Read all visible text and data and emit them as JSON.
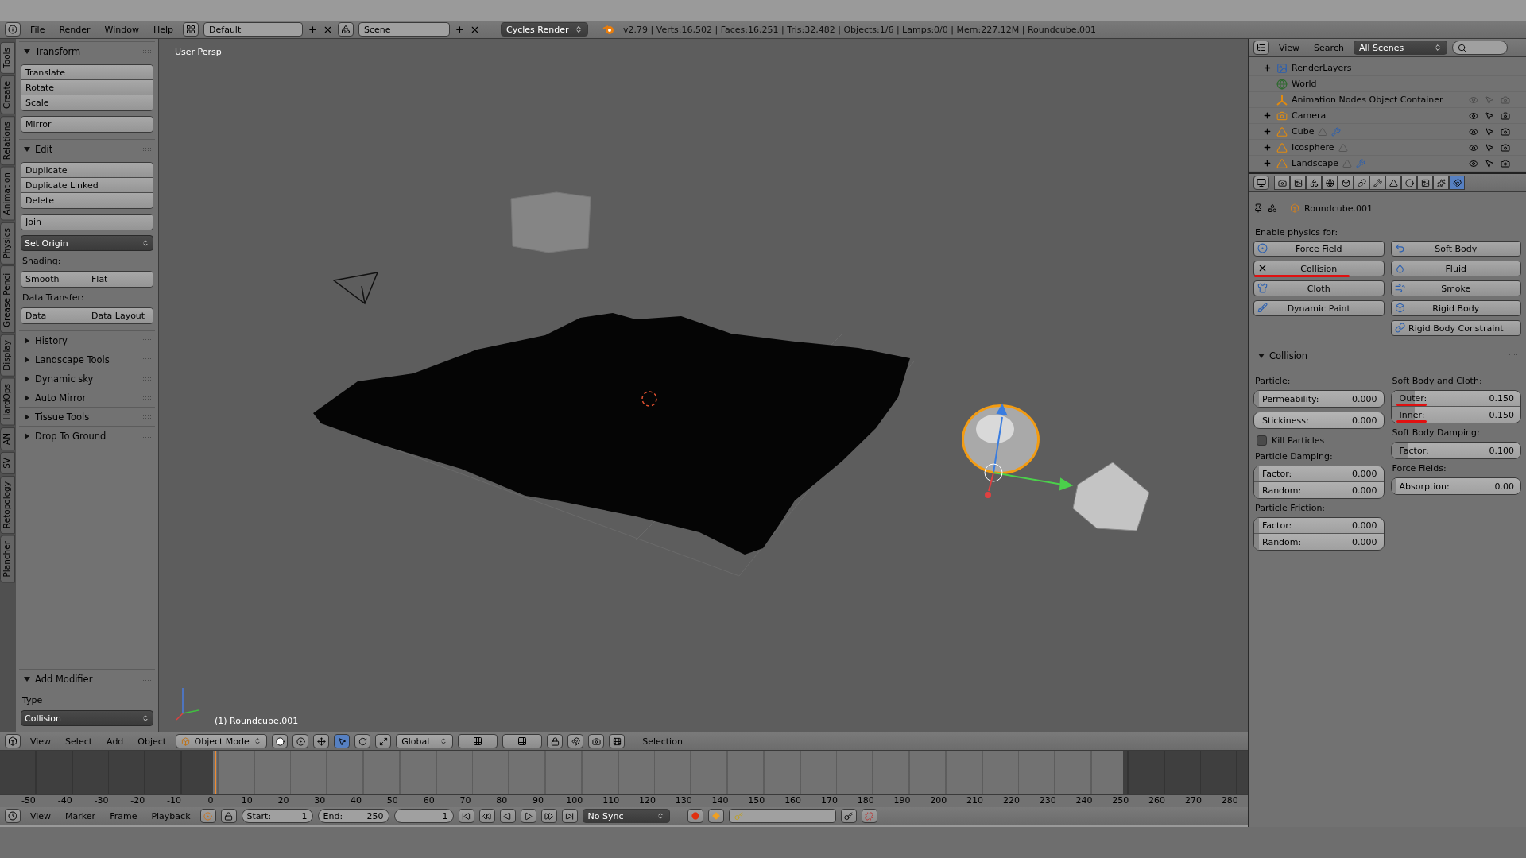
{
  "top_bar": {
    "menus": [
      "File",
      "Render",
      "Window",
      "Help"
    ],
    "layout": "Default",
    "scene": "Scene",
    "engine": "Cycles Render",
    "stats": "v2.79 | Verts:16,502 | Faces:16,251 | Tris:32,482 | Objects:1/6 | Lamps:0/0 | Mem:227.12M | Roundcube.001"
  },
  "side_tabs": [
    {
      "label": "Tools",
      "selected": true
    },
    {
      "label": "Create",
      "selected": false
    },
    {
      "label": "Relations",
      "selected": false
    },
    {
      "label": "Animation",
      "selected": false
    },
    {
      "label": "Physics",
      "selected": false
    },
    {
      "label": "Grease Pencil",
      "selected": false
    },
    {
      "label": "Display",
      "selected": false
    },
    {
      "label": "HardOps",
      "selected": false
    },
    {
      "label": "AN",
      "selected": false
    },
    {
      "label": "SV",
      "selected": false
    },
    {
      "label": "Retopology",
      "selected": false
    },
    {
      "label": "Plancher",
      "selected": false
    }
  ],
  "tool_shelf": {
    "panels": [
      {
        "title": "Transform",
        "expanded": true,
        "rows": [
          {
            "kind": "group",
            "buttons": [
              "Translate",
              "Rotate",
              "Scale"
            ]
          },
          {
            "kind": "group",
            "buttons": [
              "Mirror"
            ]
          }
        ]
      },
      {
        "title": "Edit",
        "expanded": true,
        "rows": [
          {
            "kind": "group",
            "buttons": [
              "Duplicate",
              "Duplicate Linked",
              "Delete"
            ]
          },
          {
            "kind": "group",
            "buttons": [
              "Join"
            ]
          },
          {
            "kind": "menu",
            "label": "Set Origin"
          },
          {
            "kind": "label",
            "text": "Shading:"
          },
          {
            "kind": "pair",
            "buttons": [
              "Smooth",
              "Flat"
            ]
          },
          {
            "kind": "label",
            "text": "Data Transfer:"
          },
          {
            "kind": "pair",
            "buttons": [
              "Data",
              "Data Layout"
            ]
          }
        ]
      },
      {
        "title": "History",
        "expanded": false
      },
      {
        "title": "Landscape Tools",
        "expanded": false
      },
      {
        "title": "Dynamic sky",
        "expanded": false
      },
      {
        "title": "Auto Mirror",
        "expanded": false
      },
      {
        "title": "Tissue Tools",
        "expanded": false
      },
      {
        "title": "Drop To Ground",
        "expanded": false
      }
    ]
  },
  "add_modifier": {
    "title": "Add Modifier",
    "expanded": true,
    "type_label": "Type",
    "type_value": "Collision"
  },
  "viewport": {
    "view_name": "User Persp",
    "object_label": "(1) Roundcube.001"
  },
  "viewport_header": {
    "menus": [
      "View",
      "Select",
      "Add",
      "Object"
    ],
    "mode": "Object Mode",
    "orientation": "Global",
    "status": "Selection"
  },
  "timeline": {
    "ticks": [
      "-50",
      "-40",
      "-30",
      "-20",
      "-10",
      "0",
      "10",
      "20",
      "30",
      "40",
      "50",
      "60",
      "70",
      "80",
      "90",
      "100",
      "110",
      "120",
      "130",
      "140",
      "150",
      "160",
      "170",
      "180",
      "190",
      "200",
      "210",
      "220",
      "230",
      "240",
      "250",
      "260",
      "270",
      "280"
    ]
  },
  "timeline_header": {
    "menus": [
      "View",
      "Marker",
      "Frame",
      "Playback"
    ],
    "start_label": "Start:",
    "start": "1",
    "end_label": "End:",
    "end": "250",
    "current_frame": "1",
    "sync": "No Sync"
  },
  "outliner": {
    "menus": [
      "View",
      "Search"
    ],
    "scope": "All Scenes",
    "items": [
      {
        "name": "RenderLayers",
        "kind": "render_layers",
        "modifiers": false
      },
      {
        "name": "World",
        "kind": "world",
        "modifiers": false
      },
      {
        "name": "Animation Nodes Object Container",
        "kind": "empty",
        "modifiers": false
      },
      {
        "name": "Camera",
        "kind": "camera",
        "modifiers": false
      },
      {
        "name": "Cube",
        "kind": "mesh",
        "modifiers": true
      },
      {
        "name": "Icosphere",
        "kind": "mesh",
        "modifiers": false
      },
      {
        "name": "Landscape",
        "kind": "mesh",
        "modifiers": true
      }
    ]
  },
  "properties": {
    "tabs": [
      {
        "kind": "render",
        "selected": false
      },
      {
        "kind": "render_layers",
        "selected": false
      },
      {
        "kind": "scene",
        "selected": false
      },
      {
        "kind": "world",
        "selected": false
      },
      {
        "kind": "object",
        "selected": false
      },
      {
        "kind": "constraints",
        "selected": false
      },
      {
        "kind": "modifiers",
        "selected": false
      },
      {
        "kind": "data",
        "selected": false
      },
      {
        "kind": "material",
        "selected": false
      },
      {
        "kind": "texture",
        "selected": false
      },
      {
        "kind": "particles",
        "selected": false
      },
      {
        "kind": "physics",
        "selected": true
      }
    ],
    "context": "Roundcube.001",
    "physics_label": "Enable physics for:",
    "physics_columns": [
      [
        {
          "label": "Force Field",
          "kind": "force_field",
          "enabled": false,
          "underlined": false
        },
        {
          "label": "Collision",
          "kind": "collision",
          "enabled": true,
          "underlined": true
        },
        {
          "label": "Cloth",
          "kind": "cloth",
          "enabled": false,
          "underlined": false
        },
        {
          "label": "Dynamic Paint",
          "kind": "dynamic_paint",
          "enabled": false,
          "underlined": false
        }
      ],
      [
        {
          "label": "Soft Body",
          "kind": "soft_body",
          "enabled": false,
          "underlined": false
        },
        {
          "label": "Fluid",
          "kind": "fluid",
          "enabled": false,
          "underlined": false
        },
        {
          "label": "Smoke",
          "kind": "smoke",
          "enabled": false,
          "underlined": false
        },
        {
          "label": "Rigid Body",
          "kind": "rigid_body",
          "enabled": false,
          "underlined": false
        },
        {
          "label": "Rigid Body Constraint",
          "kind": "rigid_body_constraint",
          "enabled": false,
          "underlined": false
        }
      ]
    ],
    "collision": {
      "title": "Collision",
      "expanded": true,
      "columns": [
        [
          {
            "kind": "label",
            "text": "Particle:"
          },
          {
            "kind": "sliders",
            "fields": [
              {
                "label": "Permeability:",
                "value": "0.000",
                "level": 0,
                "underlined": false
              }
            ]
          },
          {
            "kind": "spinner",
            "fields": [
              {
                "label": "Stickiness:",
                "value": "0.000",
                "underlined": false
              }
            ]
          },
          {
            "kind": "checkbox",
            "label": "Kill Particles",
            "checked": false
          },
          {
            "kind": "label",
            "text": "Particle Damping:"
          },
          {
            "kind": "sliders",
            "fields": [
              {
                "label": "Factor:",
                "value": "0.000",
                "level": 0,
                "underlined": false
              },
              {
                "label": "Random:",
                "value": "0.000",
                "level": 0,
                "underlined": false
              }
            ]
          },
          {
            "kind": "label",
            "text": "Particle Friction:"
          },
          {
            "kind": "sliders",
            "fields": [
              {
                "label": "Factor:",
                "value": "0.000",
                "level": 0,
                "underlined": false
              },
              {
                "label": "Random:",
                "value": "0.000",
                "level": 0,
                "underlined": false
              }
            ]
          }
        ],
        [
          {
            "kind": "label",
            "text": "Soft Body and Cloth:"
          },
          {
            "kind": "sliders",
            "fields": [
              {
                "label": "Outer:",
                "value": "0.150",
                "level": 0.15,
                "underlined": true
              },
              {
                "label": "Inner:",
                "value": "0.150",
                "level": 0.15,
                "underlined": true
              }
            ]
          },
          {
            "kind": "label",
            "text": "Soft Body Damping:"
          },
          {
            "kind": "sliders",
            "fields": [
              {
                "label": "Factor:",
                "value": "0.100",
                "level": 0.1,
                "underlined": false
              }
            ]
          },
          {
            "kind": "label",
            "text": "Force Fields:"
          },
          {
            "kind": "sliders",
            "fields": [
              {
                "label": "Absorption:",
                "value": "0.00",
                "level": 0,
                "underlined": false
              }
            ]
          }
        ]
      ]
    }
  }
}
